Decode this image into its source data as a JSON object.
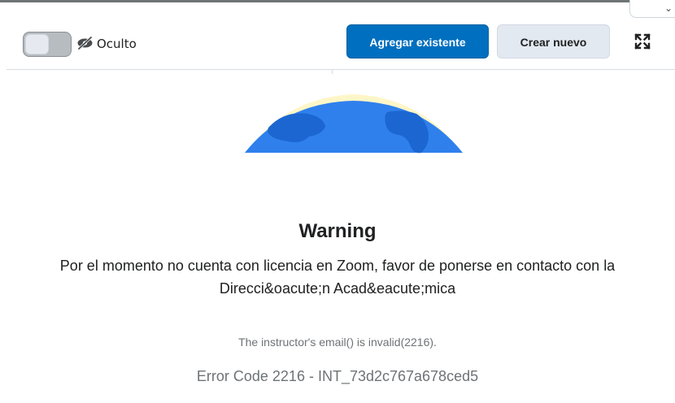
{
  "header": {
    "visibility_toggle": {
      "state": "off"
    },
    "visibility_label": "Oculto",
    "add_existing_label": "Agregar existente",
    "create_new_label": "Crear nuevo",
    "icons": {
      "visibility": "eye-off-icon",
      "fullscreen": "fullscreen-icon",
      "dropdown": "chevron-down-icon"
    }
  },
  "message": {
    "title": "Warning",
    "body": "Por el momento no cuenta con licencia en Zoom, favor de ponerse en contacto con la Direcci&oacute;n Acad&eacute;mica",
    "detail": "The instructor's email() is invalid(2216).",
    "error_code": "Error Code 2216 - INT_73d2c767a678ced5"
  },
  "colors": {
    "primary": "#006fbf",
    "secondary_bg": "#e3e9f1",
    "globe": "#2f80ed",
    "globe_dark": "#1c66d1",
    "glow": "#fff6c8",
    "muted_text": "#6e7376"
  }
}
